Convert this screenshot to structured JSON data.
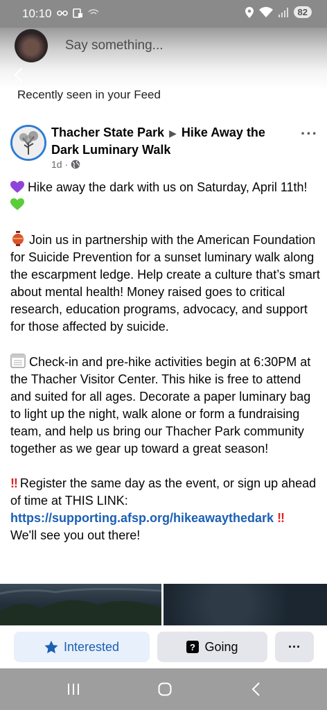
{
  "status_bar": {
    "time": "10:10",
    "battery": "82"
  },
  "composer": {
    "placeholder": "Say something..."
  },
  "feed_label": "Recently seen in your Feed",
  "post": {
    "page_name": "Thacher State Park",
    "separator": "▶",
    "event_name": "Hike Away the Dark Luminary Walk",
    "time_ago": "1d",
    "paragraph1": "Hike away the dark with us on Saturday, April 11th!",
    "paragraph2": "Join us in partnership with the American Foundation for Suicide Prevention  for a sunset luminary walk along the escarpment ledge. Help create a culture that’s smart about mental health! Money raised goes to critical research, education programs, advocacy, and support for those affected by suicide.",
    "paragraph3": "Check-in and pre-hike activities begin at 6:30PM at the Thacher Visitor Center.  This hike is free to attend and suited for all ages. Decorate a paper luminary bag to light up the night, walk alone or form a fundraising team, and help us bring our Thacher Park community together as we gear up toward a great season!",
    "paragraph4": "Register the same day as the event, or sign up ahead of time at THIS LINK:",
    "link": "https://supporting.afsp.org/hikeawaythedark",
    "closing": "We'll see you out there!",
    "bang": "‼"
  },
  "actions": {
    "interested": "Interested",
    "going": "Going",
    "more": "···"
  },
  "icons": {
    "wifi": "wifi-icon",
    "signal": "signal-icon",
    "location": "location-icon",
    "globe": "globe-icon",
    "star": "star-icon",
    "question": "question-box-icon"
  },
  "colors": {
    "accent": "#1a5fb4",
    "interested_bg": "#e7f0fb",
    "status_bar": "#8a8a8a"
  }
}
